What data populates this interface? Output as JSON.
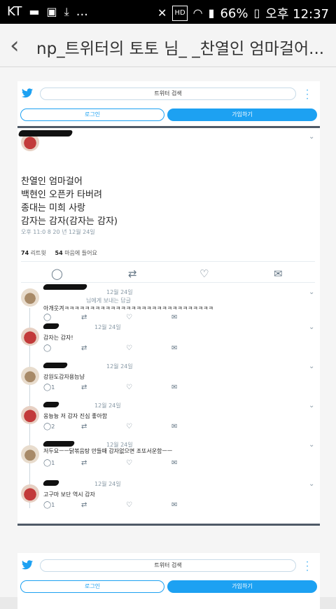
{
  "status_bar": {
    "carrier": "KT",
    "more": "...",
    "battery": "66%",
    "time": "오후 12:37"
  },
  "app_bar": {
    "title": "np_트위터의 토토 님_ _찬열인 엄마걸어..."
  },
  "twitter_header": {
    "search_placeholder": "트위터 검색",
    "login_label": "로그인",
    "signup_label": "가입하기"
  },
  "tweet": {
    "lines": [
      "찬열인 엄마걸어",
      "백현인 오픈카 타버려",
      "종대는 미희 사랑",
      "감자는 감자(감자는 감자)"
    ],
    "meta": "오후 11:0  8 20  년 12월 24일",
    "retweets_count": "74",
    "retweets_label": "리트윗",
    "likes_count": "54",
    "likes_label": "마음에 들어요"
  },
  "replies": [
    {
      "date": "12월 24일",
      "sub": "님에게 보내는 답글",
      "text": "아개웃겨ㅋㅋㅋㅋㅋㅋㅋㅋㅋㅋㅋㅋㅋㅋㅋㅋㅋㅋㅋㅋㅋㅋㅋㅋㅋㅋㅋㅋㅋ",
      "reply_count": "",
      "avatar": "dog"
    },
    {
      "date": "12월 24일",
      "text": "감자는 감자!",
      "reply_count": "",
      "avatar": "red"
    },
    {
      "date": "12월 24일",
      "text": "강원도감자용늠냠",
      "reply_count": "1",
      "avatar": "dog"
    },
    {
      "date": "12월 24일",
      "text": "옹늉늉 저 감자 진심 좋아함",
      "reply_count": "2",
      "avatar": "red"
    },
    {
      "date": "12월 24일",
      "text": "저두요ㅡㅡ닭볶음탕 만들때 감자없으면 조또서운함ㅡㅡ",
      "reply_count": "1",
      "avatar": "dog"
    },
    {
      "date": "12월 24일",
      "text": "고구마 보단 역시 감자",
      "reply_count": "1",
      "avatar": "red"
    }
  ],
  "icons": {
    "bird": "twitter-bird-icon",
    "reply": "reply-icon",
    "retweet": "retweet-icon",
    "like": "heart-icon",
    "dm": "envelope-icon"
  },
  "colors": {
    "twitter_blue": "#1da1f2",
    "dark_divider": "#4f5a67"
  }
}
